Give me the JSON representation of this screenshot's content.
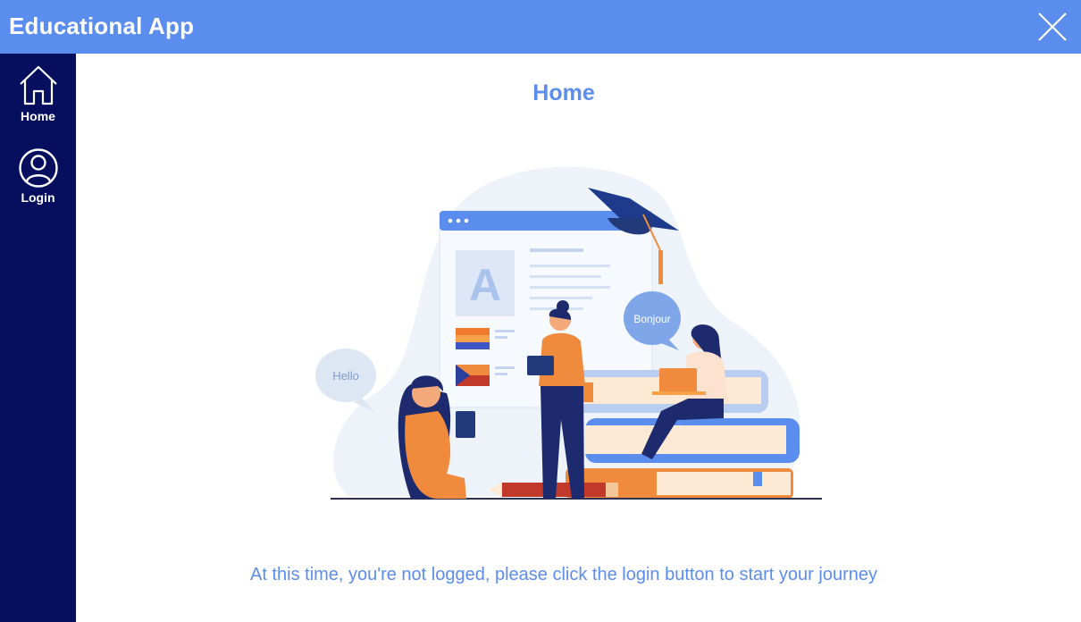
{
  "window": {
    "title": "Educational App",
    "close_icon": "close-icon"
  },
  "sidebar": {
    "items": [
      {
        "label": "Home",
        "icon": "home-icon"
      },
      {
        "label": "Login",
        "icon": "user-circle-icon"
      }
    ]
  },
  "main": {
    "page_title": "Home",
    "illustration": {
      "speech_bubbles": [
        "Hello",
        "Bonjour"
      ],
      "letter_tile": "A"
    },
    "message": "At this time, you're not logged, please click the login button to start your journey"
  },
  "colors": {
    "titlebar": "#5b8def",
    "sidebar": "#050f5e",
    "accent": "#5b8def"
  }
}
